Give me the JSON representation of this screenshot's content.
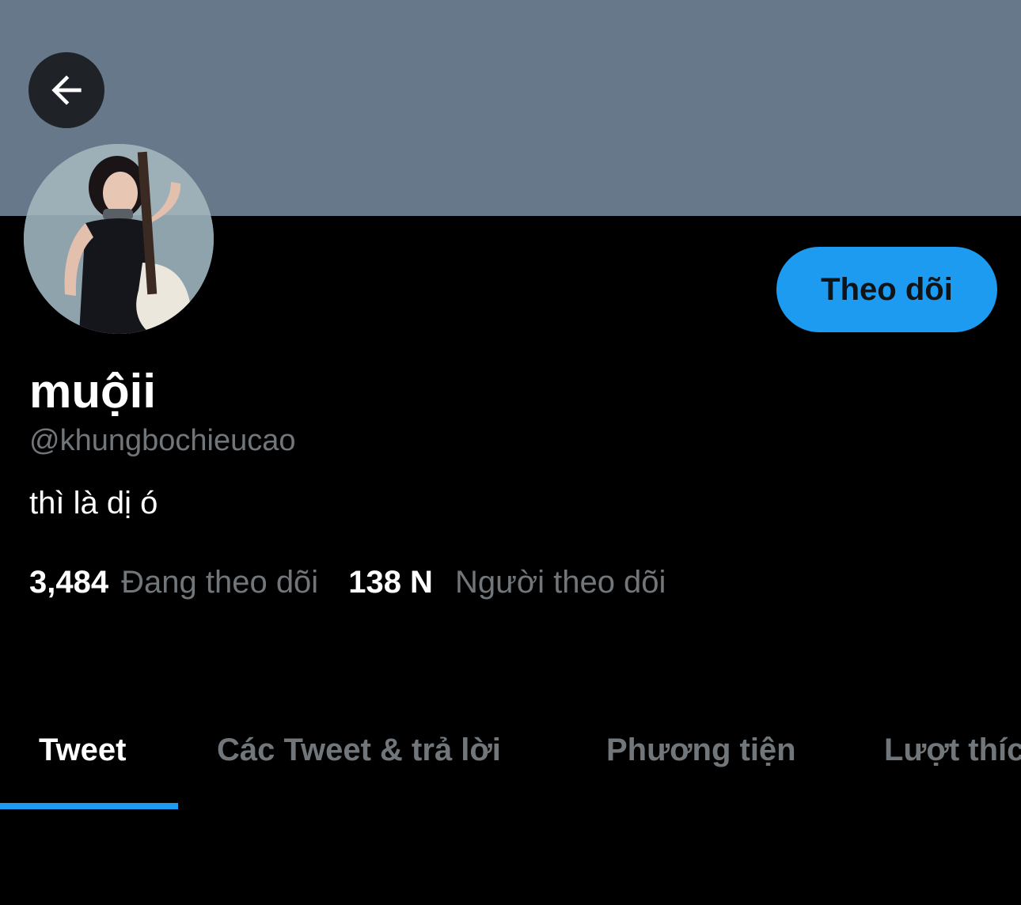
{
  "header": {
    "back_icon": "arrow-left-icon",
    "banner_color": "#66788a"
  },
  "profile": {
    "avatar_description": "profile photo",
    "display_name": "muộii",
    "handle": "@khungbochieucao",
    "bio": "thì là dị ó",
    "follow_button_label": "Theo dõi",
    "following_count": "3,484",
    "following_label": "Đang theo dõi",
    "followers_count": "138 N",
    "followers_label": "Người theo dõi"
  },
  "tabs": [
    {
      "label": "Tweet",
      "active": true
    },
    {
      "label": "Các Tweet & trả lời",
      "active": false
    },
    {
      "label": "Phương tiện",
      "active": false
    },
    {
      "label": "Lượt thích",
      "active": false
    }
  ],
  "colors": {
    "accent": "#1d9bf0",
    "background": "#000000",
    "secondary_text": "#71767b"
  }
}
